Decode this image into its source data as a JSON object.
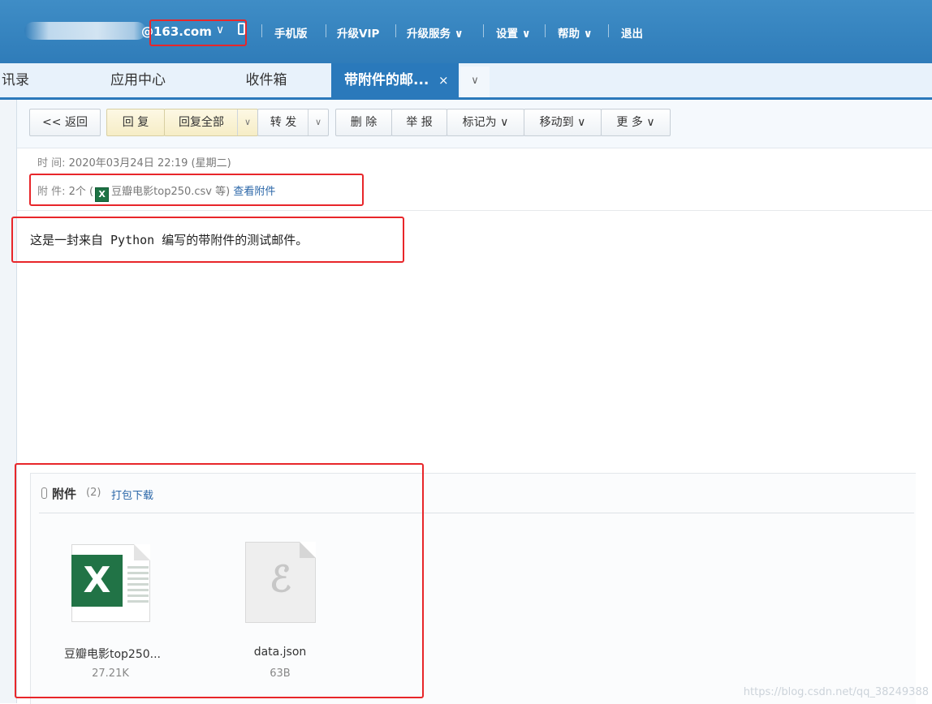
{
  "header": {
    "domain": "@163.com",
    "domain_chevron": "∨",
    "nav": [
      "手机版",
      "升级VIP",
      "升级服务 ∨",
      "设置 ∨",
      "帮助 ∨",
      "退出"
    ]
  },
  "tabs": {
    "items": [
      "讯录",
      "应用中心",
      "收件箱"
    ],
    "active": "带附件的邮...",
    "active_close": "×",
    "more": "∨"
  },
  "toolbar": {
    "back": "<< 返回",
    "reply": "回 复",
    "reply_all": "回复全部",
    "forward": "转 发",
    "delete": "删 除",
    "report": "举 报",
    "mark_as": "标记为 ∨",
    "move_to": "移动到 ∨",
    "more": "更 多 ∨",
    "dropdown": "∨"
  },
  "meta": {
    "time_label": "时  间:",
    "time_value": "2020年03月24日 22:19 (星期二)",
    "attach_label": "附  件:",
    "attach_count": "2个 (",
    "attach_file": "豆瓣电影top250.csv 等)",
    "attach_link": "查看附件"
  },
  "body": {
    "text": "这是一封来自 Python 编写的带附件的测试邮件。"
  },
  "attachments": {
    "title": "附件",
    "count": "(2)",
    "download_all": "打包下载",
    "files": [
      {
        "name": "豆瓣电影top250...",
        "size": "27.21K",
        "icon": "excel-file-icon"
      },
      {
        "name": "data.json",
        "size": "63B",
        "icon": "generic-file-icon"
      }
    ]
  },
  "watermark": "https://blog.csdn.net/qq_38249388",
  "colors": {
    "header": "#2f7cb9",
    "active_tab": "#2a79bb",
    "highlight": "#e8262a",
    "excel": "#217346",
    "link": "#2a66a8"
  }
}
